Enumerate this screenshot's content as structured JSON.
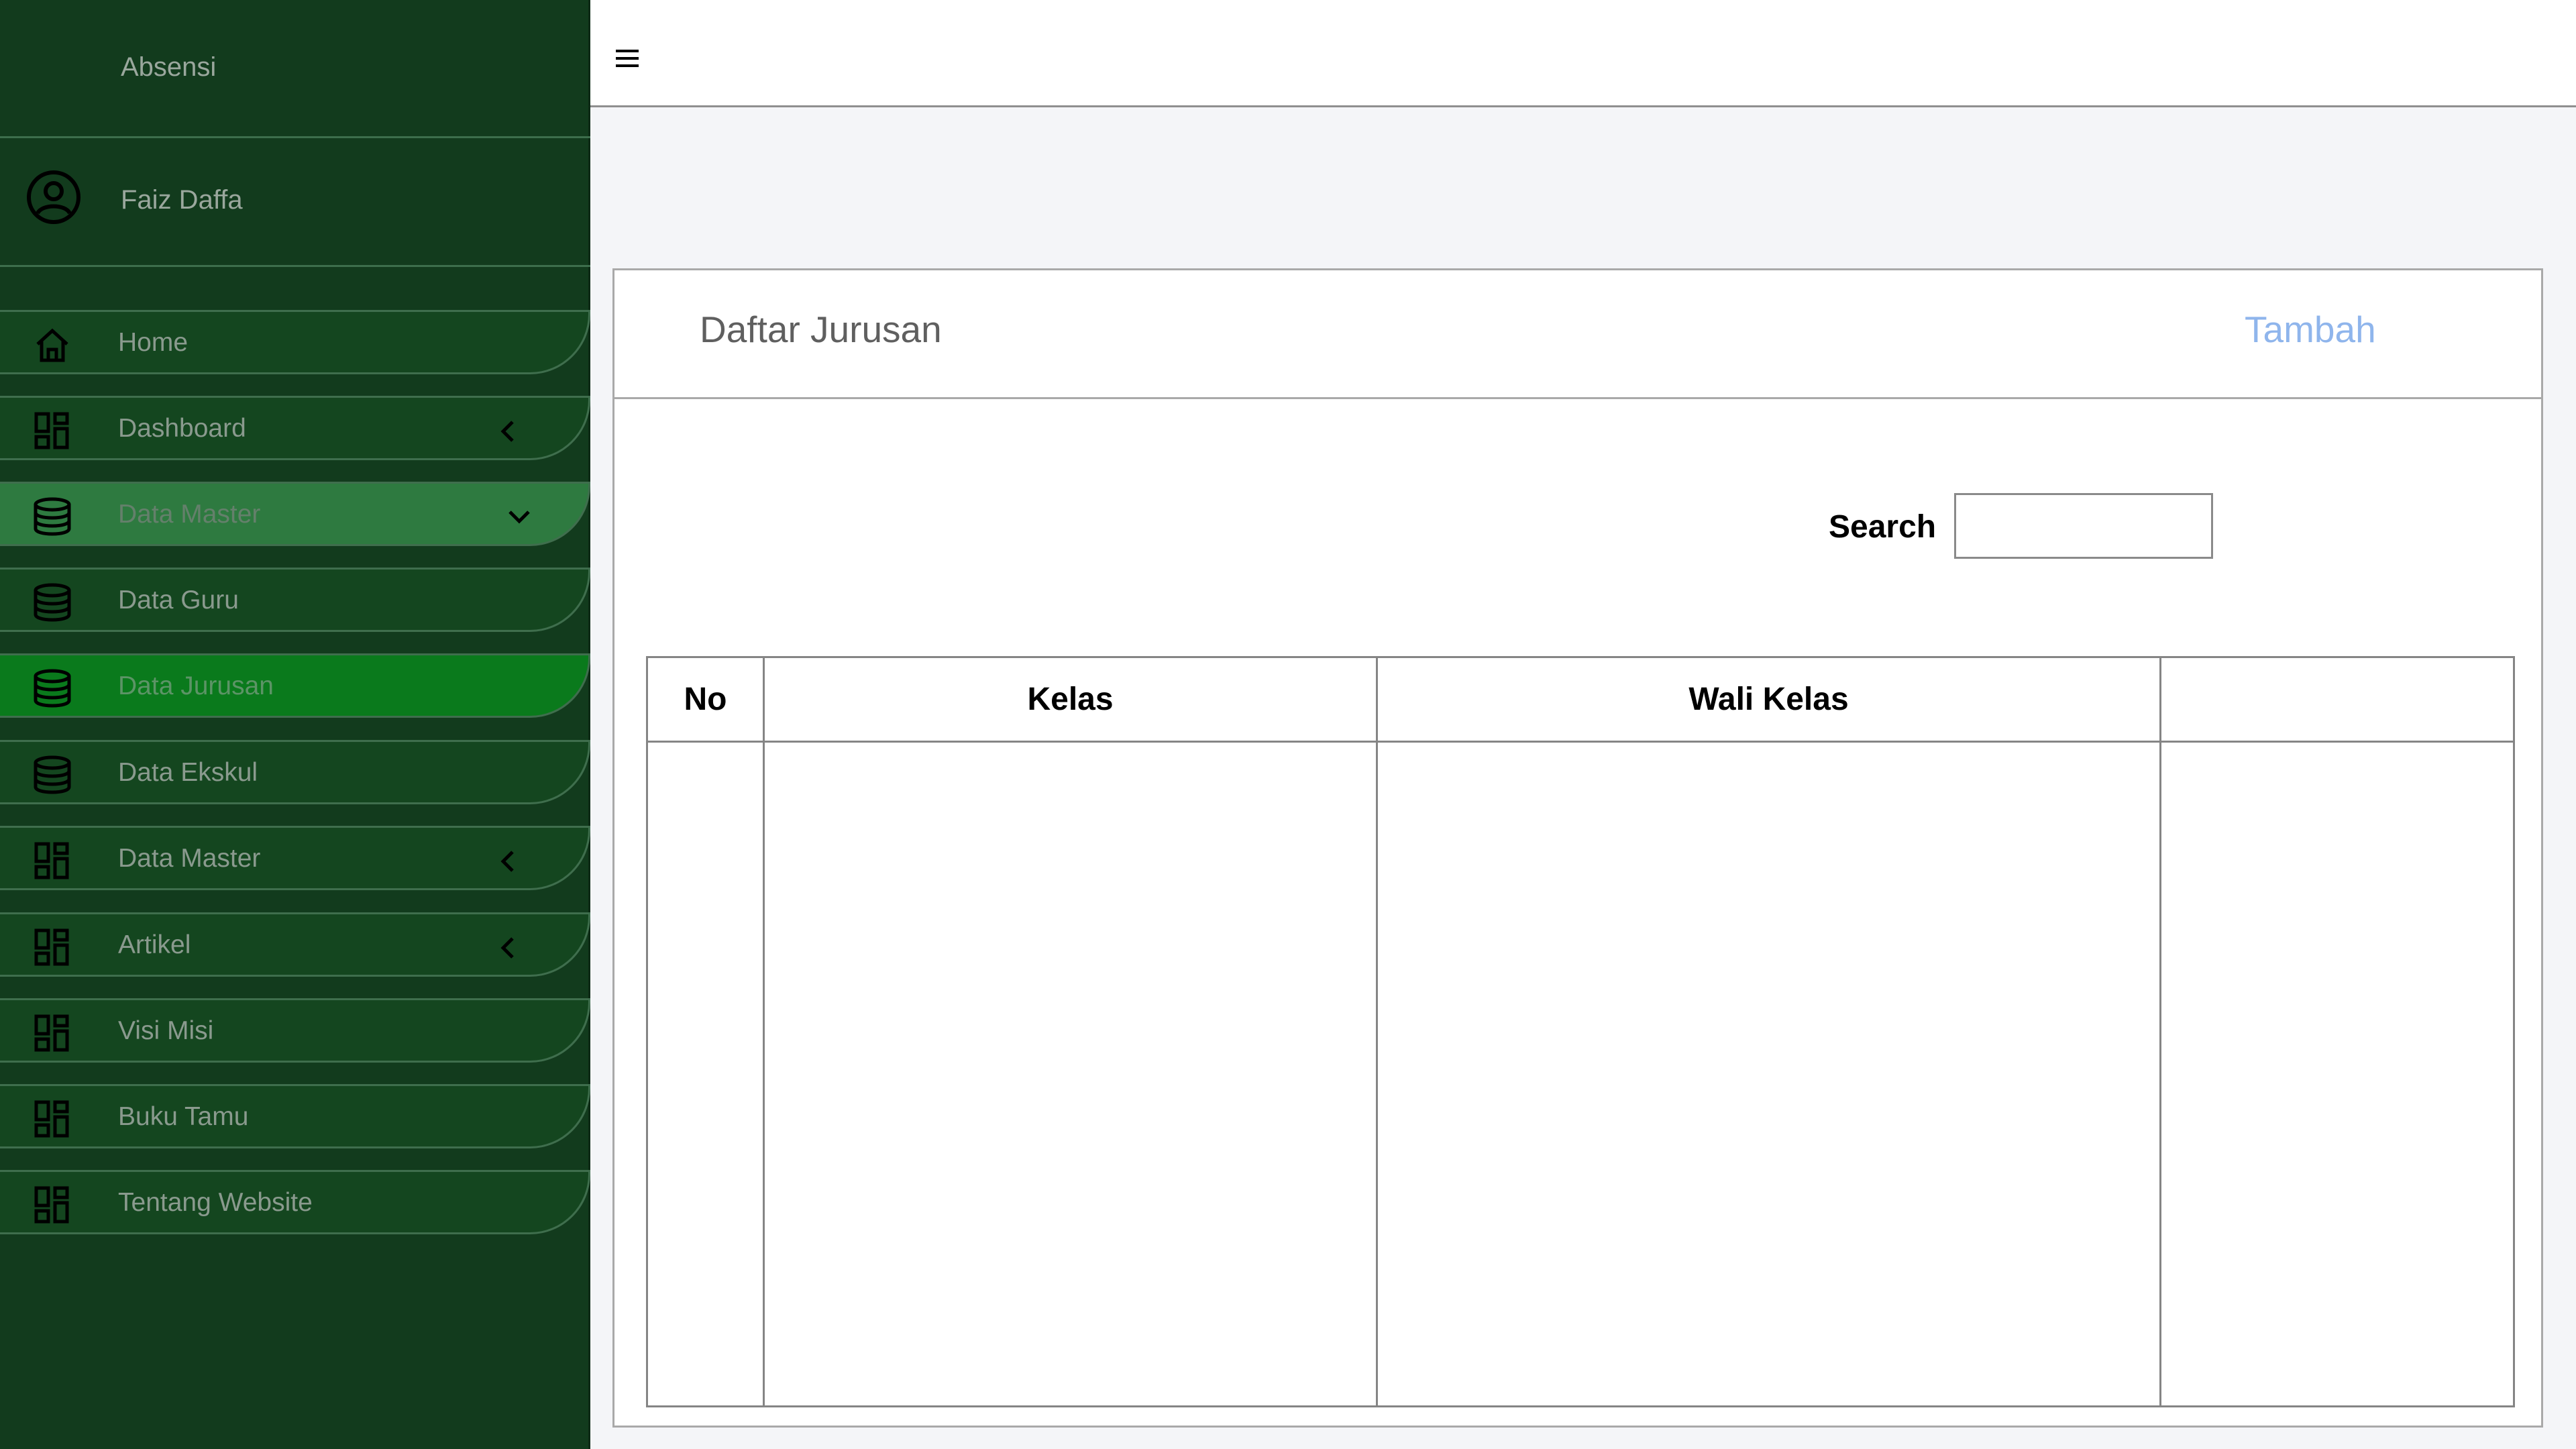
{
  "sidebar": {
    "brand": "Absensi",
    "user_name": "Faiz Daffa",
    "items": [
      {
        "label": "Home",
        "icon": "home-icon",
        "arrow": "none"
      },
      {
        "label": "Dashboard",
        "icon": "dashboard-icon",
        "arrow": "chevron-left-icon"
      },
      {
        "label": "Data Master",
        "icon": "database-icon",
        "arrow": "chevron-down-icon"
      },
      {
        "label": "Data Guru",
        "icon": "database-icon",
        "arrow": "none"
      },
      {
        "label": "Data Jurusan",
        "icon": "database-icon",
        "arrow": "none"
      },
      {
        "label": "Data Ekskul",
        "icon": "database-icon",
        "arrow": "none"
      },
      {
        "label": "Data Master",
        "icon": "dashboard-icon",
        "arrow": "chevron-left-icon"
      },
      {
        "label": "Artikel",
        "icon": "dashboard-icon",
        "arrow": "chevron-left-icon"
      },
      {
        "label": "Visi Misi",
        "icon": "dashboard-icon",
        "arrow": "none"
      },
      {
        "label": "Buku Tamu",
        "icon": "dashboard-icon",
        "arrow": "none"
      },
      {
        "label": "Tentang Website",
        "icon": "dashboard-icon",
        "arrow": "none"
      }
    ]
  },
  "topbar": {
    "menu_icon": "hamburger-menu-icon"
  },
  "main": {
    "title": "Daftar Jurusan",
    "add_label": "Tambah",
    "search_label": "Search",
    "search_value": "",
    "table": {
      "headers": [
        "No",
        "Kelas",
        "Wali Kelas",
        ""
      ],
      "rows": []
    }
  },
  "colors": {
    "sidebar_bg": "#123b1d",
    "active_item": "#0a7a1c",
    "open_item": "#2e7a40",
    "accent_link": "#8fb5ec"
  }
}
